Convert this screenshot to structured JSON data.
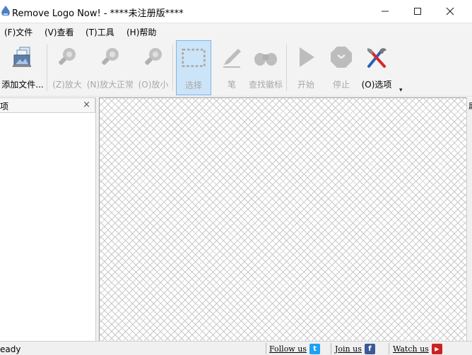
{
  "window": {
    "title": "Remove Logo Now! - ****未注册版****",
    "minimize_glyph": "─",
    "maximize_glyph": "☐",
    "close_glyph": "✕"
  },
  "menu": [
    {
      "label": "(F)文件"
    },
    {
      "label": "(V)查看"
    },
    {
      "label": "(T)工具"
    },
    {
      "label": "(H)帮助"
    }
  ],
  "toolbar": {
    "add_files": {
      "label": "添加文件...",
      "icon": "add-files-icon"
    },
    "zoom_in": {
      "label": "(Z)放大",
      "icon": "zoom-in-icon"
    },
    "zoom_normal": {
      "label": "(N)放大正常",
      "icon": "zoom-normal-icon"
    },
    "zoom_out": {
      "label": "(O)放小",
      "icon": "zoom-out-icon"
    },
    "select": {
      "label": "选择",
      "icon": "select-icon"
    },
    "pen": {
      "label": "笔",
      "icon": "pen-icon"
    },
    "find_logo": {
      "label": "查找徽标",
      "icon": "binoculars-icon"
    },
    "start": {
      "label": "开始",
      "icon": "play-icon"
    },
    "stop": {
      "label": "停止",
      "icon": "stop-icon"
    },
    "options": {
      "label": "(O)选项",
      "icon": "tools-icon"
    },
    "overflow_glyph": "▾"
  },
  "left_panel": {
    "title": "项",
    "close_glyph": "×"
  },
  "right_panel": {
    "label": "属"
  },
  "status": {
    "text": "eady"
  },
  "social": {
    "follow_us": "Follow us",
    "join_us": "Join us",
    "watch_us": "Watch us",
    "twitter_glyph": "t",
    "facebook_glyph": "f",
    "youtube_glyph": "▶"
  },
  "colors": {
    "toolbar_bg": "#f3f3f3",
    "selected_bg": "#cce4f7",
    "disabled_icon": "#b5b5b5",
    "twitter": "#1da1f2",
    "facebook": "#3b5998",
    "youtube": "#cc2020"
  }
}
